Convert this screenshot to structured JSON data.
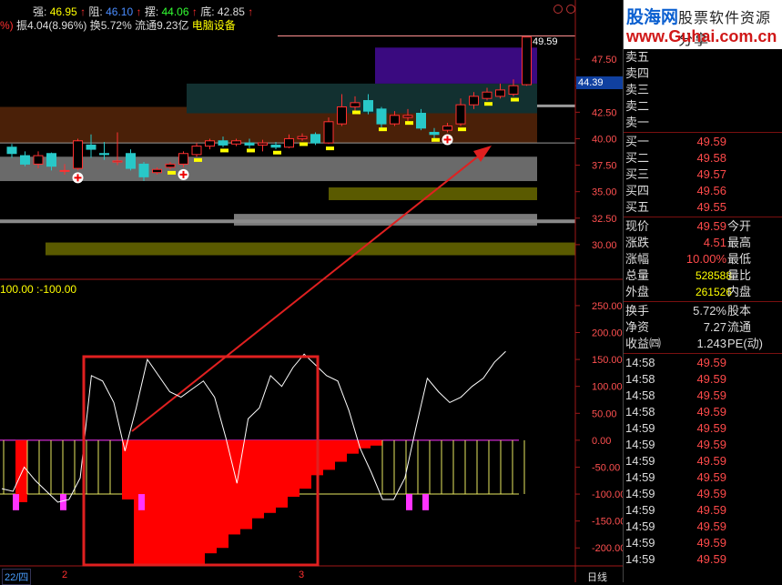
{
  "header": {
    "strong_label": "强:",
    "strong_value": "46.95",
    "mid_label": "阻:",
    "mid_value": "46.10",
    "swing_label": "摆:",
    "swing_value": "44.06",
    "bottom_label": "底:",
    "bottom_value": "42.85",
    "line2": "振4.04(8.96%) 换5.72% 流通9.23亿",
    "sector": "电脑设备"
  },
  "indicator_header": "100.00 :-100.00",
  "price_axis": [
    "47.50",
    "45.00",
    "42.50",
    "40.00",
    "37.50",
    "35.00",
    "32.50",
    "30.00"
  ],
  "osc_axis": [
    "250.00",
    "200.00",
    "150.00",
    "100.00",
    "50.00",
    "0.00",
    "-50.00",
    "-100.00",
    "-150.00",
    "-200.00"
  ],
  "current_price_tag": "44.39",
  "last_price_label": "49.59",
  "bottom_axis": {
    "date_label": "22/四",
    "mark2": "2",
    "mark3": "3",
    "period": "日线"
  },
  "colors": {
    "up": "#ff3030",
    "down": "#28c8c8",
    "oscillator_fill": "#ff0000",
    "pink": "#ff33ff",
    "yellow": "#e8e860"
  },
  "chart_data": [
    {
      "type": "candlestick",
      "title": "",
      "ylim": [
        27.5,
        50
      ],
      "ticks": [
        47.5,
        45,
        42.5,
        40,
        37.5,
        35,
        32.5,
        30
      ],
      "candles": [
        {
          "o": 39.2,
          "c": 38.6,
          "h": 39.5,
          "l": 38.2
        },
        {
          "o": 38.4,
          "c": 37.6,
          "h": 38.8,
          "l": 37.4
        },
        {
          "o": 37.6,
          "c": 38.4,
          "h": 38.8,
          "l": 37.2
        },
        {
          "o": 38.6,
          "c": 37.4,
          "h": 38.7,
          "l": 37.0
        },
        {
          "o": 37.0,
          "c": 37.0,
          "h": 37.6,
          "l": 36.6
        },
        {
          "o": 37.2,
          "c": 39.8,
          "h": 40.0,
          "l": 37.0
        },
        {
          "o": 39.4,
          "c": 39.0,
          "h": 40.4,
          "l": 38.2
        },
        {
          "o": 38.6,
          "c": 38.5,
          "h": 39.7,
          "l": 38.0
        },
        {
          "o": 37.8,
          "c": 37.9,
          "h": 40.6,
          "l": 37.5
        },
        {
          "o": 38.6,
          "c": 37.2,
          "h": 39.0,
          "l": 37.0
        },
        {
          "o": 37.6,
          "c": 36.4,
          "h": 37.8,
          "l": 36.0
        },
        {
          "o": 36.8,
          "c": 37.1,
          "h": 37.3,
          "l": 36.6
        },
        {
          "o": 37.3,
          "c": 37.6,
          "h": 37.8,
          "l": 37.1
        },
        {
          "o": 37.6,
          "c": 38.6,
          "h": 38.8,
          "l": 37.3
        },
        {
          "o": 38.5,
          "c": 39.3,
          "h": 39.6,
          "l": 38.3
        },
        {
          "o": 39.3,
          "c": 39.8,
          "h": 40.0,
          "l": 39.0
        },
        {
          "o": 39.8,
          "c": 39.4,
          "h": 40.2,
          "l": 39.2
        },
        {
          "o": 39.5,
          "c": 39.8,
          "h": 40.0,
          "l": 39.3
        },
        {
          "o": 39.6,
          "c": 39.4,
          "h": 40.0,
          "l": 39.1
        },
        {
          "o": 39.4,
          "c": 39.6,
          "h": 39.9,
          "l": 38.8
        },
        {
          "o": 39.4,
          "c": 39.2,
          "h": 39.7,
          "l": 39.0
        },
        {
          "o": 39.2,
          "c": 40.0,
          "h": 40.4,
          "l": 39.1
        },
        {
          "o": 40.0,
          "c": 40.2,
          "h": 40.5,
          "l": 39.8
        },
        {
          "o": 40.4,
          "c": 39.6,
          "h": 40.6,
          "l": 39.4
        },
        {
          "o": 39.6,
          "c": 41.6,
          "h": 42.0,
          "l": 39.5
        },
        {
          "o": 41.4,
          "c": 43.0,
          "h": 44.2,
          "l": 41.2
        },
        {
          "o": 43.0,
          "c": 43.4,
          "h": 44.0,
          "l": 42.6
        },
        {
          "o": 43.6,
          "c": 42.6,
          "h": 44.2,
          "l": 42.3
        },
        {
          "o": 42.8,
          "c": 41.4,
          "h": 43.0,
          "l": 41.0
        },
        {
          "o": 41.4,
          "c": 42.2,
          "h": 42.6,
          "l": 41.2
        },
        {
          "o": 42.0,
          "c": 42.2,
          "h": 42.8,
          "l": 41.6
        },
        {
          "o": 42.4,
          "c": 41.0,
          "h": 42.8,
          "l": 40.8
        },
        {
          "o": 40.6,
          "c": 40.4,
          "h": 41.0,
          "l": 39.8
        },
        {
          "o": 40.8,
          "c": 41.2,
          "h": 41.5,
          "l": 40.6
        },
        {
          "o": 41.4,
          "c": 43.2,
          "h": 43.8,
          "l": 41.2
        },
        {
          "o": 43.2,
          "c": 44.0,
          "h": 44.4,
          "l": 42.8
        },
        {
          "o": 43.8,
          "c": 44.4,
          "h": 44.8,
          "l": 43.6
        },
        {
          "o": 44.0,
          "c": 44.6,
          "h": 45.2,
          "l": 43.8
        },
        {
          "o": 44.2,
          "c": 45.0,
          "h": 45.6,
          "l": 44.0
        },
        {
          "o": 45.1,
          "c": 49.59,
          "h": 49.59,
          "l": 45.0
        }
      ],
      "zones": [
        {
          "from": 29.0,
          "to": 30.2,
          "color": "#5a5a00"
        },
        {
          "from": 31.8,
          "to": 32.9,
          "color": "#7a7a7a"
        },
        {
          "from": 34.2,
          "to": 35.4,
          "color": "#5a5a00"
        },
        {
          "from": 36.0,
          "to": 38.3,
          "color": "#6a6a6a"
        },
        {
          "from": 39.6,
          "to": 43.0,
          "color": "#4a2008"
        },
        {
          "from": 42.4,
          "to": 45.2,
          "color": "#123030"
        },
        {
          "from": 45.2,
          "to": 48.6,
          "color": "#3a0a80"
        }
      ]
    },
    {
      "type": "bar",
      "title": "",
      "ylim": [
        -230,
        260
      ],
      "line": [
        -90,
        -95,
        -50,
        -75,
        -95,
        -115,
        -110,
        -70,
        120,
        110,
        70,
        -20,
        60,
        150,
        120,
        90,
        80,
        95,
        110,
        80,
        5,
        -80,
        40,
        60,
        120,
        100,
        135,
        160,
        140,
        120,
        110,
        55,
        -15,
        -60,
        -110,
        -110,
        -70,
        25,
        115,
        90,
        70,
        80,
        100,
        115,
        145,
        165
      ],
      "bars": [
        -100,
        -115,
        -100,
        -95,
        -95,
        -100,
        -100,
        -100,
        -100,
        -100,
        -110,
        -230,
        -230,
        -230,
        -230,
        -230,
        -230,
        -210,
        -200,
        -175,
        -165,
        -145,
        -135,
        -125,
        -105,
        -90,
        -65,
        -55,
        -40,
        -25,
        -15,
        -10,
        -100,
        -100,
        -100,
        -100,
        -100,
        -100,
        -100,
        -100,
        -100,
        -100,
        -100,
        -100,
        -100
      ],
      "pink_bars": [
        0,
        3,
        10,
        27,
        28
      ]
    }
  ],
  "side_panel": {
    "logo_main": "股海网",
    "logo_tag": "股票软件资源分享",
    "logo_url": "www.Guhai.com.cn",
    "sell": [
      {
        "label": "卖五",
        "price": ""
      },
      {
        "label": "卖四",
        "price": ""
      },
      {
        "label": "卖三",
        "price": ""
      },
      {
        "label": "卖二",
        "price": ""
      },
      {
        "label": "卖一",
        "price": ""
      }
    ],
    "buy": [
      {
        "label": "买一",
        "price": "49.59",
        "vol": ""
      },
      {
        "label": "买二",
        "price": "49.58",
        "vol": ""
      },
      {
        "label": "买三",
        "price": "49.57",
        "vol": ""
      },
      {
        "label": "买四",
        "price": "49.56",
        "vol": ""
      },
      {
        "label": "买五",
        "price": "49.55",
        "vol": ""
      }
    ],
    "stats": [
      {
        "a": "现价",
        "b": "49.59",
        "d": "今开"
      },
      {
        "a": "涨跌",
        "b": "4.51",
        "d": "最高"
      },
      {
        "a": "涨幅",
        "b": "10.00%",
        "d": "最低"
      },
      {
        "a": "总量",
        "b": "528588",
        "d": "量比"
      },
      {
        "a": "外盘",
        "b": "261526",
        "d": "内盘"
      }
    ],
    "stats2": [
      {
        "a": "换手",
        "b": "5.72%",
        "d": "股本"
      },
      {
        "a": "净资",
        "b": "7.27",
        "d": "流通"
      },
      {
        "a": "收益㈣",
        "b": "1.243",
        "d": "PE(动)"
      }
    ],
    "ticks": [
      {
        "t": "14:58",
        "p": "49.59"
      },
      {
        "t": "14:58",
        "p": "49.59"
      },
      {
        "t": "14:58",
        "p": "49.59"
      },
      {
        "t": "14:58",
        "p": "49.59"
      },
      {
        "t": "14:59",
        "p": "49.59"
      },
      {
        "t": "14:59",
        "p": "49.59"
      },
      {
        "t": "14:59",
        "p": "49.59"
      },
      {
        "t": "14:59",
        "p": "49.59"
      },
      {
        "t": "14:59",
        "p": "49.59"
      },
      {
        "t": "14:59",
        "p": "49.59"
      },
      {
        "t": "14:59",
        "p": "49.59"
      },
      {
        "t": "14:59",
        "p": "49.59"
      },
      {
        "t": "14:59",
        "p": "49.59"
      }
    ]
  }
}
